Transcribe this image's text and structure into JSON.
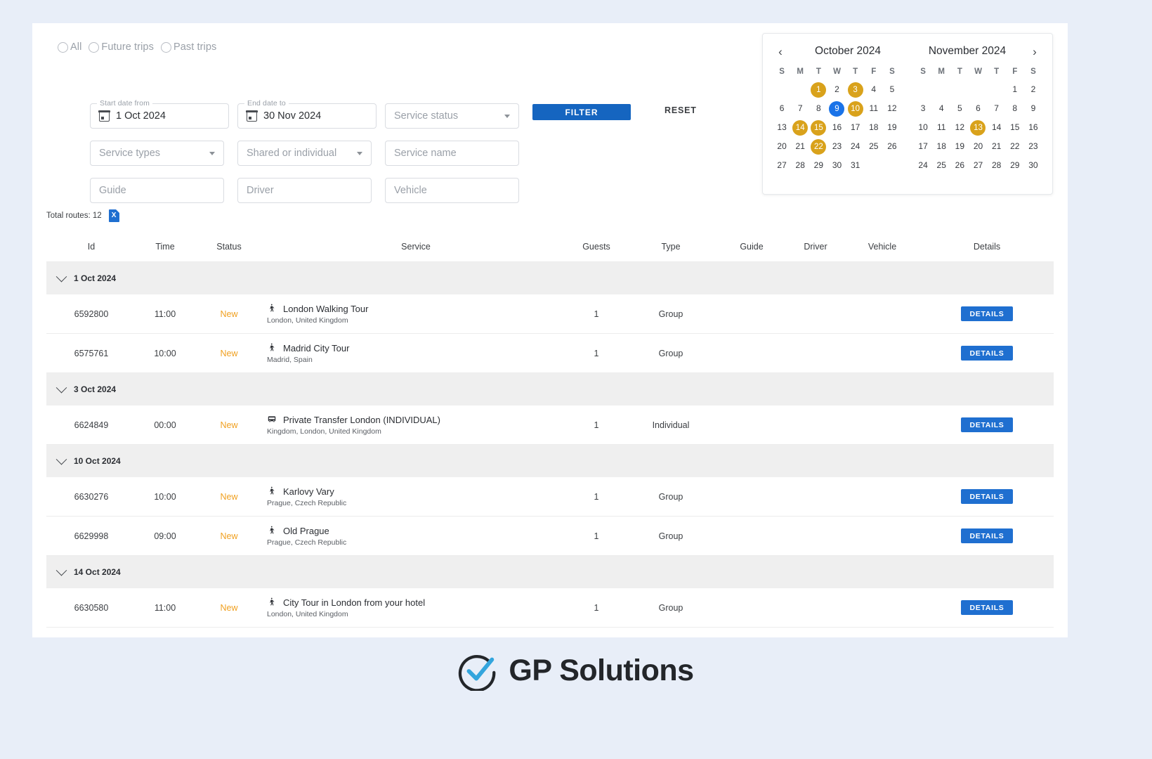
{
  "filters": {
    "trip_scope": [
      {
        "label": "All",
        "selected": false
      },
      {
        "label": "Future trips",
        "selected": false
      },
      {
        "label": "Past trips",
        "selected": false
      }
    ],
    "start_date": {
      "legend": "Start date from",
      "value": "1 Oct 2024"
    },
    "end_date": {
      "legend": "End date to",
      "value": "30 Nov 2024"
    },
    "service_status": {
      "placeholder": "Service status"
    },
    "service_types": {
      "placeholder": "Service types"
    },
    "shared_or_individual": {
      "placeholder": "Shared or individual"
    },
    "service_name": {
      "placeholder": "Service name"
    },
    "guide": {
      "placeholder": "Guide"
    },
    "driver": {
      "placeholder": "Driver"
    },
    "vehicle": {
      "placeholder": "Vehicle"
    },
    "filter_button": "FILTER",
    "reset_button": "RESET"
  },
  "calendar": {
    "prev_icon": "‹",
    "next_icon": "›",
    "dow": [
      "S",
      "M",
      "T",
      "W",
      "T",
      "F",
      "S"
    ],
    "months": [
      {
        "title": "October 2024",
        "weeks": [
          [
            "",
            "",
            "1",
            "2",
            "3",
            "4",
            "5"
          ],
          [
            "6",
            "7",
            "8",
            "9",
            "10",
            "11",
            "12"
          ],
          [
            "13",
            "14",
            "15",
            "16",
            "17",
            "18",
            "19"
          ],
          [
            "20",
            "21",
            "22",
            "23",
            "24",
            "25",
            "26"
          ],
          [
            "27",
            "28",
            "29",
            "30",
            "31",
            "",
            ""
          ]
        ],
        "marked": [
          "1",
          "3",
          "10",
          "14",
          "15",
          "22"
        ],
        "today": "9"
      },
      {
        "title": "November 2024",
        "weeks": [
          [
            "",
            "",
            "",
            "",
            "",
            "1",
            "2"
          ],
          [
            "3",
            "4",
            "5",
            "6",
            "7",
            "8",
            "9"
          ],
          [
            "10",
            "11",
            "12",
            "13",
            "14",
            "15",
            "16"
          ],
          [
            "17",
            "18",
            "19",
            "20",
            "21",
            "22",
            "23"
          ],
          [
            "24",
            "25",
            "26",
            "27",
            "28",
            "29",
            "30"
          ]
        ],
        "marked": [
          "13"
        ],
        "today": ""
      }
    ]
  },
  "summary": {
    "total_routes": "Total routes: 12",
    "export_label": "X"
  },
  "table": {
    "columns": [
      "Id",
      "Time",
      "Status",
      "Service",
      "Guests",
      "Type",
      "Guide",
      "Driver",
      "Vehicle",
      "Details"
    ],
    "details_label": "DETAILS",
    "groups": [
      {
        "date": "1 Oct 2024",
        "rows": [
          {
            "id": "6592800",
            "time": "11:00",
            "status": "New",
            "icon": "walking-tour-icon",
            "service": "London Walking Tour",
            "location": "London, United Kingdom",
            "guests": "1",
            "type": "Group",
            "guide": "",
            "driver": "",
            "vehicle": ""
          },
          {
            "id": "6575761",
            "time": "10:00",
            "status": "New",
            "icon": "walking-tour-icon",
            "service": "Madrid City Tour",
            "location": "Madrid, Spain",
            "guests": "1",
            "type": "Group",
            "guide": "",
            "driver": "",
            "vehicle": ""
          }
        ]
      },
      {
        "date": "3 Oct 2024",
        "rows": [
          {
            "id": "6624849",
            "time": "00:00",
            "status": "New",
            "icon": "transfer-bus-icon",
            "service": "Private Transfer London (INDIVIDUAL)",
            "location": "Kingdom, London, United Kingdom",
            "guests": "1",
            "type": "Individual",
            "guide": "",
            "driver": "",
            "vehicle": ""
          }
        ]
      },
      {
        "date": "10 Oct 2024",
        "rows": [
          {
            "id": "6630276",
            "time": "10:00",
            "status": "New",
            "icon": "walking-tour-icon",
            "service": "Karlovy Vary",
            "location": "Prague, Czech Republic",
            "guests": "1",
            "type": "Group",
            "guide": "",
            "driver": "",
            "vehicle": ""
          },
          {
            "id": "6629998",
            "time": "09:00",
            "status": "New",
            "icon": "walking-tour-icon",
            "service": "Old Prague",
            "location": "Prague, Czech Republic",
            "guests": "1",
            "type": "Group",
            "guide": "",
            "driver": "",
            "vehicle": ""
          }
        ]
      },
      {
        "date": "14 Oct 2024",
        "rows": [
          {
            "id": "6630580",
            "time": "11:00",
            "status": "New",
            "icon": "walking-tour-icon",
            "service": "City Tour in London from your hotel",
            "location": "London, United Kingdom",
            "guests": "1",
            "type": "Group",
            "guide": "",
            "driver": "",
            "vehicle": ""
          }
        ]
      }
    ]
  },
  "footer": {
    "brand": "GP Solutions"
  },
  "colors": {
    "accent_blue": "#1f6fd0",
    "filter_blue": "#1565c0",
    "marked_day": "#d9a21b",
    "today_blue": "#1a73e8",
    "status_new": "#f0a020",
    "page_bg": "#e8eef8"
  }
}
